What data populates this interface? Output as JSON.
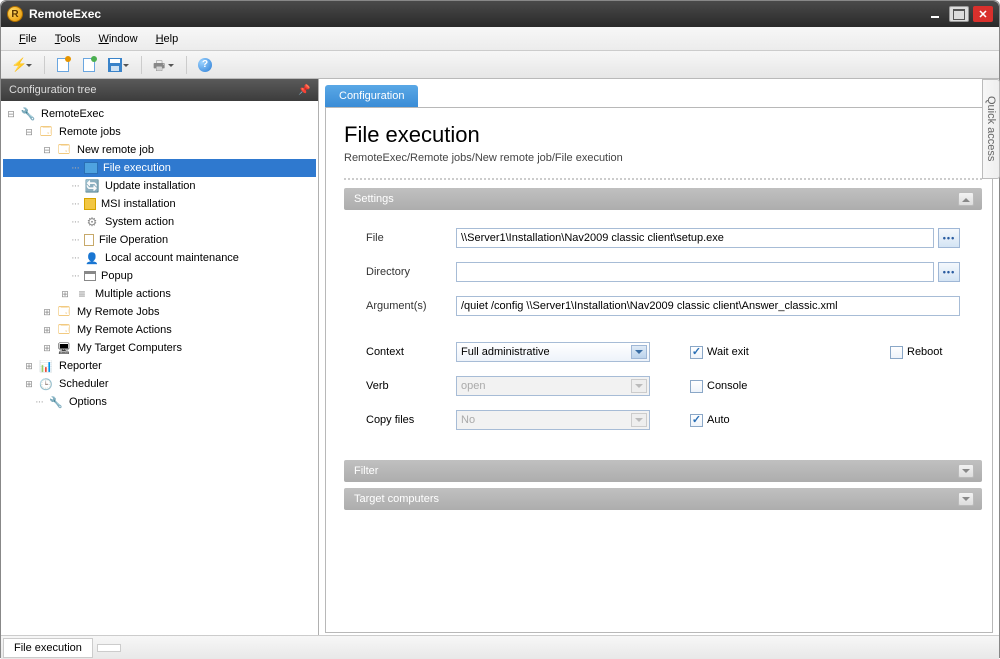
{
  "app": {
    "title": "RemoteExec"
  },
  "menus": {
    "file": "File",
    "tools": "Tools",
    "window": "Window",
    "help": "Help"
  },
  "sidebar": {
    "header": "Configuration tree",
    "nodes": {
      "root": "RemoteExec",
      "remote_jobs": "Remote jobs",
      "new_remote_job": "New remote job",
      "file_execution": "File execution",
      "update_installation": "Update installation",
      "msi_installation": "MSI installation",
      "system_action": "System action",
      "file_operation": "File Operation",
      "local_account": "Local account maintenance",
      "popup": "Popup",
      "multiple_actions": "Multiple actions",
      "my_remote_jobs": "My Remote Jobs",
      "my_remote_actions": "My Remote Actions",
      "my_target_computers": "My Target Computers",
      "reporter": "Reporter",
      "scheduler": "Scheduler",
      "options": "Options"
    }
  },
  "tab": {
    "configuration": "Configuration"
  },
  "page": {
    "title": "File execution",
    "breadcrumb": "RemoteExec/Remote jobs/New remote job/File execution"
  },
  "sections": {
    "settings": "Settings",
    "filter": "Filter",
    "target": "Target computers"
  },
  "form": {
    "labels": {
      "file": "File",
      "directory": "Directory",
      "arguments": "Argument(s)",
      "context": "Context",
      "verb": "Verb",
      "copy_files": "Copy files"
    },
    "values": {
      "file": "\\\\Server1\\Installation\\Nav2009 classic client\\setup.exe",
      "directory": "",
      "arguments": "/quiet /config \\\\Server1\\Installation\\Nav2009 classic client\\Answer_classic.xml",
      "context": "Full administrative",
      "verb": "open",
      "copy_files": "No"
    },
    "checkboxes": {
      "wait_exit": {
        "label": "Wait exit",
        "checked": true
      },
      "reboot": {
        "label": "Reboot",
        "checked": false
      },
      "console": {
        "label": "Console",
        "checked": false
      },
      "auto": {
        "label": "Auto",
        "checked": true
      }
    }
  },
  "quick_access": "Quick access",
  "status": {
    "cell": "File execution"
  }
}
